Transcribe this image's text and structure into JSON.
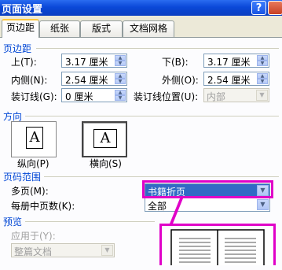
{
  "window": {
    "title": "页面设置"
  },
  "title_buttons": {
    "help": "?"
  },
  "tabs": [
    {
      "label": "页边距",
      "active": true
    },
    {
      "label": "纸张",
      "active": false
    },
    {
      "label": "版式",
      "active": false
    },
    {
      "label": "文档网格",
      "active": false
    }
  ],
  "margins": {
    "section_title": "页边距",
    "top_label": "上(T):",
    "top_value": "3.17 厘米",
    "bottom_label": "下(B):",
    "bottom_value": "3.17 厘米",
    "inside_label": "内侧(N):",
    "inside_value": "2.54 厘米",
    "outside_label": "外侧(O):",
    "outside_value": "2.54 厘米",
    "gutter_label": "装订线(G):",
    "gutter_value": "0 厘米",
    "gutter_pos_label": "装订线位置(U):",
    "gutter_pos_value": "内部"
  },
  "orientation": {
    "section_title": "方向",
    "portrait_label": "纵向(P)",
    "landscape_label": "横向(S)",
    "page_glyph": "A"
  },
  "pages": {
    "section_title": "页码范围",
    "multiple_label": "多页(M):",
    "multiple_value": "书籍折页",
    "per_booklet_label": "每册中页数(K):",
    "per_booklet_value": "全部"
  },
  "preview": {
    "section_title": "预览",
    "apply_label": "应用于(Y):",
    "apply_value": "整篇文档"
  },
  "highlight_color": "#e000c8"
}
